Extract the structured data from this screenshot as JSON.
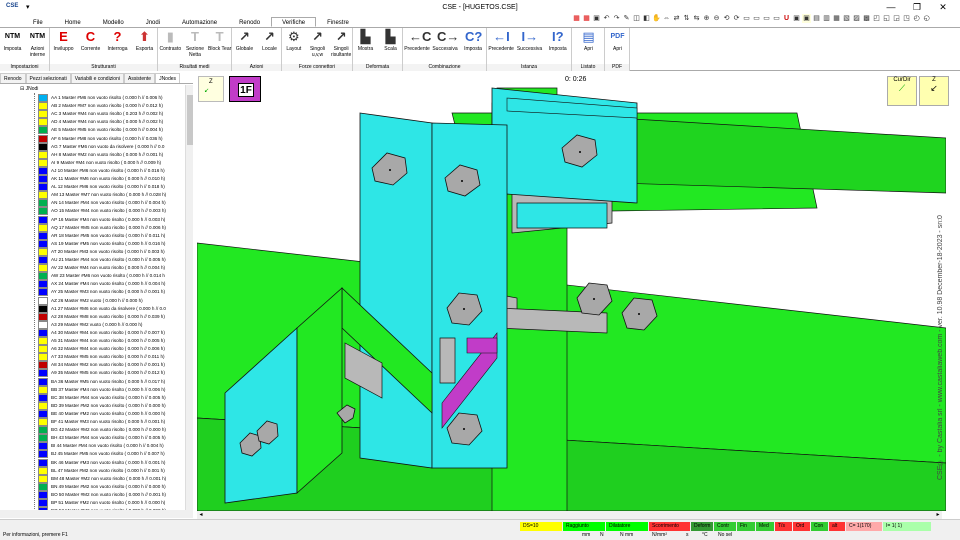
{
  "app": {
    "title": "CSE - [HUGETOS.CSE]",
    "logo": "CSE",
    "window_buttons": [
      "—",
      "❐",
      "✕"
    ]
  },
  "menu_tabs": [
    "File",
    "Home",
    "Modello",
    "Jnodi",
    "Automazione",
    "Renodo",
    "Verifiche",
    "Finestre"
  ],
  "active_tab": "Verifiche",
  "ribbon": {
    "groups": [
      {
        "label": "Impostazioni",
        "buttons": [
          {
            "icon": "NTM",
            "label": "Imposta"
          },
          {
            "icon": "NTM",
            "label": "Azioni interne"
          }
        ]
      },
      {
        "label": "Strutturanti",
        "buttons": [
          {
            "icon": "E",
            "label": "Inviluppo"
          },
          {
            "icon": "C",
            "label": "Corrente"
          },
          {
            "icon": "?",
            "label": "Interroga"
          },
          {
            "icon": "⬆",
            "label": "Esporta"
          }
        ]
      },
      {
        "label": "Risultati medi",
        "buttons": [
          {
            "icon": "▮",
            "label": "Contrasto"
          },
          {
            "icon": "T",
            "label": "Sezione Netta"
          },
          {
            "icon": "T",
            "label": "Block Tear"
          }
        ]
      },
      {
        "label": "Azioni",
        "buttons": [
          {
            "icon": "↗",
            "label": "Globale"
          },
          {
            "icon": "↗",
            "label": "Locale"
          }
        ]
      },
      {
        "label": "Forze connettori",
        "buttons": [
          {
            "icon": "⚙",
            "label": "Layout"
          },
          {
            "icon": "↗",
            "label": "Singoli u,v,w"
          },
          {
            "icon": "↗",
            "label": "Singoli risultante"
          }
        ]
      },
      {
        "label": "Deformata",
        "buttons": [
          {
            "icon": "▙",
            "label": "Mostra"
          },
          {
            "icon": "▙",
            "label": "Scala"
          }
        ]
      },
      {
        "label": "Combinazione",
        "buttons": [
          {
            "icon": "←C",
            "label": "Precedente"
          },
          {
            "icon": "C→",
            "label": "Successiva"
          },
          {
            "icon": "C?",
            "label": "Imposta"
          }
        ]
      },
      {
        "label": "Istanza",
        "buttons": [
          {
            "icon": "←I",
            "label": "Precedente"
          },
          {
            "icon": "I→",
            "label": "Successiva"
          },
          {
            "icon": "I?",
            "label": "Imposta"
          }
        ]
      },
      {
        "label": "Listato",
        "buttons": [
          {
            "icon": "▤",
            "label": "Apri"
          }
        ]
      },
      {
        "label": "PDF",
        "buttons": [
          {
            "icon": "PDF",
            "label": "Apri"
          }
        ]
      }
    ]
  },
  "left_panel": {
    "tabs": [
      "Renodo",
      "Pezzi selezionati",
      "Variabili e condizioni",
      "Assistente",
      "JNodes"
    ],
    "active_tab": "JNodes",
    "tree_root": "JNodi",
    "items": [
      {
        "label": "AA 1  Master  #M6 non vuoto risolto ( 0.000 h  //  0.006 h)",
        "color": "#00b0f0"
      },
      {
        "label": "AB 2  Master  #M7 non vuoto risolto ( 0.000 h  //  0.012 h)",
        "color": "#ffff00"
      },
      {
        "label": "AC 3  Master  #M4 non vuoto risolto ( 0.203 h  //  0.002 h)",
        "color": "#ffff00"
      },
      {
        "label": "AD 4  Master  #M4 non vuoto risolto ( 0.000 h  //  0.002 h)",
        "color": "#ffff00"
      },
      {
        "label": "AE 5  Master  #M5 non vuoto risolto ( 0.000 h  //  0.004 h)",
        "color": "#00b050"
      },
      {
        "label": "AF 6  Master  #M8 non vuoto risolto ( 0.000 h  //  0.036 h)",
        "color": "#c00000"
      },
      {
        "label": "AG 7  Master  #M6 non vuoto da risolvere ( 0.000 h  //  0.0",
        "color": "#000000"
      },
      {
        "label": "AH 8  Master  #M2 non vuoto risolto ( 0.000 h  //  0.001 h)",
        "color": "#ffff00"
      },
      {
        "label": "AI 9  Master  #M4 non vuoto risolto ( 0.000 h  //  0.009 h)",
        "color": "#ffff00"
      },
      {
        "label": "AJ 10  Master  #M6 non vuoto risolto ( 0.000 h  //  0.016 h)",
        "color": "#0000ff"
      },
      {
        "label": "AK 11  Master  #M6 non vuoto risolto ( 0.000 h  //  0.010 h)",
        "color": "#0000ff"
      },
      {
        "label": "AL 12  Master  #M6 non vuoto risolto ( 0.000 h  //  0.018 h)",
        "color": "#0000ff"
      },
      {
        "label": "AM 13  Master  #M7 non vuoto risolto ( 0.000 h  //  0.028 h)",
        "color": "#ffff00"
      },
      {
        "label": "AN 14  Master  #M4 non vuoto risolto ( 0.000 h  //  0.004 h)",
        "color": "#00b050"
      },
      {
        "label": "AO 15  Master  #M4 non vuoto risolto ( 0.000 h  //  0.003 h)",
        "color": "#00b050"
      },
      {
        "label": "AP 16  Master  #M4 non vuoto risolto ( 0.000 h  //  0.003 h)",
        "color": "#0000ff"
      },
      {
        "label": "AQ 17  Master  #M5 non vuoto risolto ( 0.000 h  //  0.006 h)",
        "color": "#ffff00"
      },
      {
        "label": "AR 18  Master  #M5 non vuoto risolto ( 0.000 h  //  0.011 h)",
        "color": "#0000ff"
      },
      {
        "label": "AS 19  Master  #M5 non vuoto risolto ( 0.000 h  //  0.016 h)",
        "color": "#0000ff"
      },
      {
        "label": "AT 20  Master  #M3 non vuoto risolto ( 0.000 h  //  0.003 h)",
        "color": "#ffff00"
      },
      {
        "label": "AU 21  Master  #M4 non vuoto risolto ( 0.000 h  //  0.005 h)",
        "color": "#0000ff"
      },
      {
        "label": "AV 22  Master  #M4 non vuoto risolto ( 0.000 h  //  0.004 h)",
        "color": "#ffff00"
      },
      {
        "label": "AW 23  Master  #M6 non vuoto risolto ( 0.000 h  //  0.014 h",
        "color": "#00b050"
      },
      {
        "label": "AX 24  Master  #M4 non vuoto risolto ( 0.000 h  //  0.004 h)",
        "color": "#0000ff"
      },
      {
        "label": "AY 25  Master  #M3 non vuoto risolto ( 0.000 h  //  0.001 h)",
        "color": "#0000ff"
      },
      {
        "label": "AZ 26  Master  #M2 vuoto ( 0.000 h  //  0.000 h)",
        "color": "#ffffff"
      },
      {
        "label": "A1 27  Master  #M6 non vuoto da risolvere ( 0.000 h  //  0.0",
        "color": "#000000"
      },
      {
        "label": "A2 28  Master  #M8 non vuoto risolto ( 0.000 h  //  0.039 h)",
        "color": "#c00000"
      },
      {
        "label": "A3 29  Master  #M2 vuoto ( 0.000 h  //  0.000 h)",
        "color": "#ffffff"
      },
      {
        "label": "A4 30  Master  #M4 non vuoto risolto ( 0.000 h  //  0.007 h)",
        "color": "#0000ff"
      },
      {
        "label": "A5 31  Master  #M4 non vuoto risolto ( 0.000 h  //  0.005 h)",
        "color": "#ffff00"
      },
      {
        "label": "A6 32  Master  #M4 non vuoto risolto ( 0.000 h  //  0.006 h)",
        "color": "#ffff00"
      },
      {
        "label": "A7 33  Master  #M5 non vuoto risolto ( 0.000 h  //  0.011 h)",
        "color": "#ffff00"
      },
      {
        "label": "A8 34  Master  #M2 non vuoto risolto ( 0.000 h  //  0.001 h)",
        "color": "#c00000"
      },
      {
        "label": "A9 35  Master  #M5 non vuoto risolto ( 0.000 h  //  0.012 h)",
        "color": "#0000ff"
      },
      {
        "label": "BA 36  Master  #M5 non vuoto risolto ( 0.000 h  //  0.017 h)",
        "color": "#0000ff"
      },
      {
        "label": "BB 37  Master  #M4 non vuoto risolto ( 0.000 h  //  0.006 h)",
        "color": "#ffff00"
      },
      {
        "label": "BC 38  Master  #M4 non vuoto risolto ( 0.000 h  //  0.005 h)",
        "color": "#0000ff"
      },
      {
        "label": "BD 39  Master  #M2 non vuoto risolto ( 0.000 h  //  0.000 h)",
        "color": "#ffff00"
      },
      {
        "label": "BE 40  Master  #M2 non vuoto risolto ( 0.000 h  //  0.000 h)",
        "color": "#0000ff"
      },
      {
        "label": "BF 41  Master  #M3 non vuoto risolto ( 0.000 h  //  0.001 h)",
        "color": "#ffff00"
      },
      {
        "label": "BG 42  Master  #M2 non vuoto risolto ( 0.000 h  //  0.000 h)",
        "color": "#00b050"
      },
      {
        "label": "BH 43  Master  #M4 non vuoto risolto ( 0.000 h  //  0.005 h)",
        "color": "#00b050"
      },
      {
        "label": "BI 44  Master  #M4 non vuoto risolto ( 0.000 h  //  0.004 h)",
        "color": "#0000ff"
      },
      {
        "label": "BJ 45  Master  #M5 non vuoto risolto ( 0.000 h  //  0.007 h)",
        "color": "#0000ff"
      },
      {
        "label": "BK 46  Master  #M3 non vuoto risolto ( 0.000 h  //  0.001 h)",
        "color": "#0000ff"
      },
      {
        "label": "BL 47  Master  #M2 non vuoto risolto ( 0.000 h  //  0.001 h)",
        "color": "#ffff00"
      },
      {
        "label": "BM 48  Master  #M2 non vuoto risolto ( 0.000 h  //  0.001 h)",
        "color": "#ffff00"
      },
      {
        "label": "BN 49  Master  #M2 non vuoto risolto ( 0.000 h  //  0.000 h)",
        "color": "#00b050"
      },
      {
        "label": "BO 50  Master  #M2 non vuoto risolto ( 0.000 h  //  0.001 h)",
        "color": "#0000ff"
      },
      {
        "label": "BP 51  Master  #M2 non vuoto risolto ( 0.000 h  //  0.000 h)",
        "color": "#0000ff"
      },
      {
        "label": "BQ 52  Master  #M2 non vuoto risolto ( 0.000 h  //  0.000 h)",
        "color": "#0000ff"
      }
    ]
  },
  "viewport": {
    "timer": "0: 0:26",
    "badge": "1F",
    "axis_label": "Z",
    "curdir_label": "CurDir",
    "z_label": "Z",
    "watermark": "CSE© - by Castalia srl - www.castaliaweb.com - ver. 10.98 December-18-2023 - sn:0"
  },
  "statusbar": {
    "info": "Per informazioni, premere F1",
    "cells": [
      {
        "text": "DS=10",
        "bg": "#ffff00"
      },
      {
        "text": "Raggiunto",
        "bg": "#00ff00"
      },
      {
        "text": "Dilatatore",
        "bg": "#00ff00"
      },
      {
        "text": "Scorrimento",
        "bg": "#ff3333"
      },
      {
        "text": "Deform",
        "bg": "#339933"
      },
      {
        "text": "Contr",
        "bg": "#33cc33"
      },
      {
        "text": "Fin",
        "bg": "#33cc33"
      },
      {
        "text": "Med",
        "bg": "#33cc33"
      },
      {
        "text": "T/s",
        "bg": "#ff3333"
      },
      {
        "text": "Ord",
        "bg": "#ff3333"
      },
      {
        "text": "Con",
        "bg": "#33cc33"
      },
      {
        "text": "alt",
        "bg": "#ff3333"
      },
      {
        "text": "C= 1(170)",
        "bg": "#ffaaaa"
      },
      {
        "text": "I= 1( 1)",
        "bg": "#aaffaa"
      }
    ],
    "units": [
      "mm",
      "N",
      "N mm",
      "N/mm²",
      "s",
      "°C",
      "No sel"
    ]
  },
  "colors": {
    "steel_green": "#22e822",
    "plate_cyan": "#2ee6e6",
    "bolt_gray": "#a8a8a8",
    "badge_magenta": "#c13cc8"
  }
}
